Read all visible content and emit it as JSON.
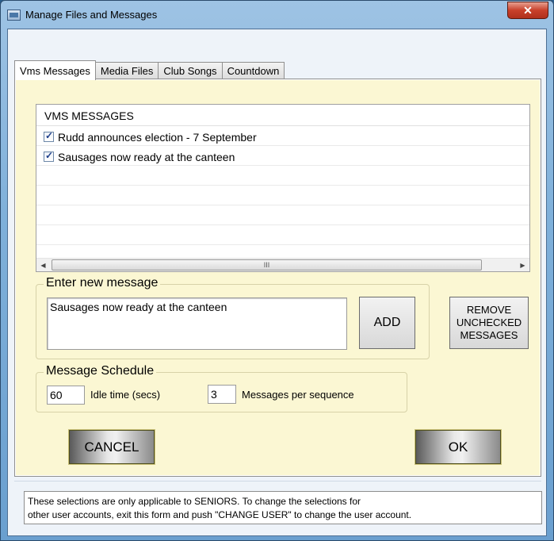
{
  "window": {
    "title": "Manage Files and Messages",
    "close_label": "✕"
  },
  "tabs": [
    {
      "label": "Vms Messages",
      "active": true
    },
    {
      "label": "Media Files",
      "active": false
    },
    {
      "label": "Club Songs",
      "active": false
    },
    {
      "label": "Countdown",
      "active": false
    }
  ],
  "messages_list": {
    "header": "VMS MESSAGES",
    "items": [
      {
        "label": "Rudd announces election - 7 September",
        "checked": true
      },
      {
        "label": "Sausages now ready at the canteen",
        "checked": true
      }
    ],
    "scroll_thumb_glyph": "III"
  },
  "new_message": {
    "group_label": "Enter new message",
    "value": "Sausages now ready at the canteen",
    "add_label": "ADD",
    "remove_label_line1": "REMOVE",
    "remove_label_line2": "UNCHECKED",
    "remove_label_line3": "MESSAGES"
  },
  "schedule": {
    "group_label": "Message Schedule",
    "idle_value": "60",
    "idle_label": "Idle time (secs)",
    "per_sequence_value": "3",
    "per_sequence_label": "Messages per sequence"
  },
  "actions": {
    "cancel_label": "CANCEL",
    "ok_label": "OK"
  },
  "footer": {
    "line1": "These selections are only applicable to SENIORS. To change the selections for",
    "line2": "other user accounts, exit this form and push \"CHANGE USER\" to change the user account."
  },
  "colors": {
    "tab_page_background": "#fbf7d3",
    "close_button": "#c8402a"
  }
}
